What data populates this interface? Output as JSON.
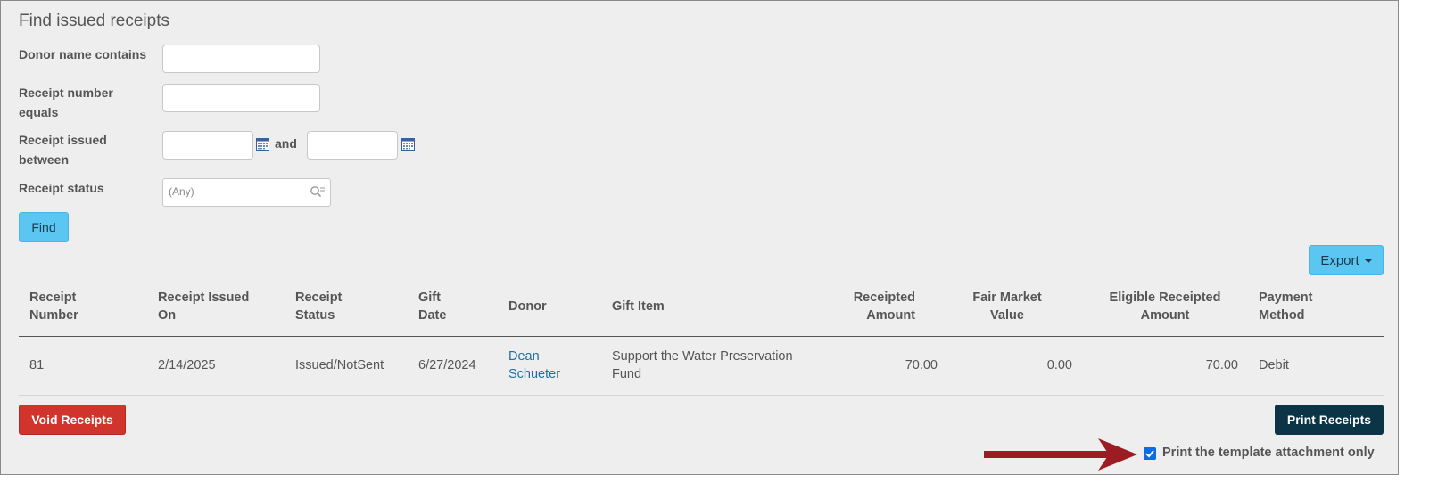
{
  "page": {
    "title": "Find issued receipts"
  },
  "filters": {
    "donor_name_label": "Donor name contains",
    "donor_name_value": "",
    "receipt_number_label": "Receipt number equals",
    "receipt_number_value": "",
    "issued_between_label": "Receipt issued between",
    "issued_from_value": "",
    "and_label": "and",
    "issued_to_value": "",
    "status_label": "Receipt status",
    "status_value": "(Any)"
  },
  "buttons": {
    "find": "Find",
    "export": "Export",
    "void": "Void Receipts",
    "print": "Print Receipts"
  },
  "table": {
    "headers": [
      "Receipt Number",
      "Receipt Issued On",
      "Receipt Status",
      "Gift Date",
      "Donor",
      "Gift Item",
      "Receipted Amount",
      "Fair Market Value",
      "Eligible Receipted Amount",
      "Payment Method"
    ],
    "rows": [
      {
        "receipt_number": "81",
        "issued_on": "2/14/2025",
        "status": "Issued/NotSent",
        "gift_date": "6/27/2024",
        "donor": "Dean Schueter",
        "gift_item": "Support the Water Preservation Fund",
        "receipted_amount": "70.00",
        "fair_market_value": "0.00",
        "eligible_amount": "70.00",
        "payment_method": "Debit"
      }
    ]
  },
  "options": {
    "template_only_label": "Print the template attachment only",
    "template_only_checked": true
  },
  "colors": {
    "accent": "#5bc6f2",
    "danger": "#d0342c",
    "primary": "#0c3447",
    "annotation_arrow": "#9b1c22"
  },
  "icons": {
    "calendar": "calendar-icon",
    "search": "search-icon",
    "caret": "caret-down-icon",
    "arrow": "annotation-arrow"
  }
}
